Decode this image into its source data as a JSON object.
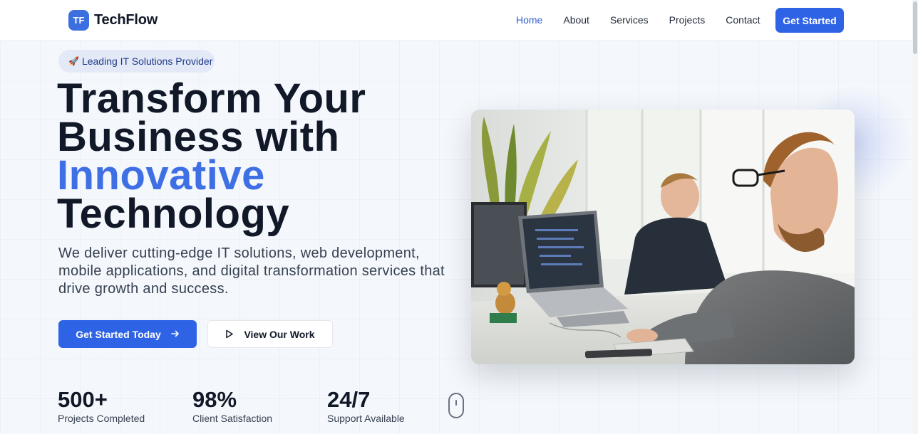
{
  "brand": {
    "badge": "TF",
    "name": "TechFlow"
  },
  "nav": {
    "links": [
      "Home",
      "About",
      "Services",
      "Projects",
      "Contact"
    ],
    "active": "Home",
    "cta": "Get Started"
  },
  "hero": {
    "badge_icon": "rocket-icon",
    "badge_emoji": "🚀",
    "badge_text": "Leading IT Solutions Provider",
    "title_lines": [
      "Transform Your",
      "Business with",
      "Innovative",
      "Technology"
    ],
    "title_accent": "Innovative",
    "subtitle": "We deliver cutting-edge IT solutions, web development, mobile applications, and digital transformation services that drive growth and success.",
    "primary_button": "Get Started Today",
    "primary_icon": "arrow-right-icon",
    "secondary_button": "View Our Work",
    "secondary_icon": "play-icon",
    "image_icon": "office-photo"
  },
  "stats": [
    {
      "value": "500+",
      "label": "Projects Completed"
    },
    {
      "value": "98%",
      "label": "Client Satisfaction"
    },
    {
      "value": "24/7",
      "label": "Support Available"
    }
  ],
  "colors": {
    "accent": "#3f6fe4",
    "primary_button": "#2f63e6",
    "text": "#111827",
    "badge_bg": "#e3e9f6"
  }
}
